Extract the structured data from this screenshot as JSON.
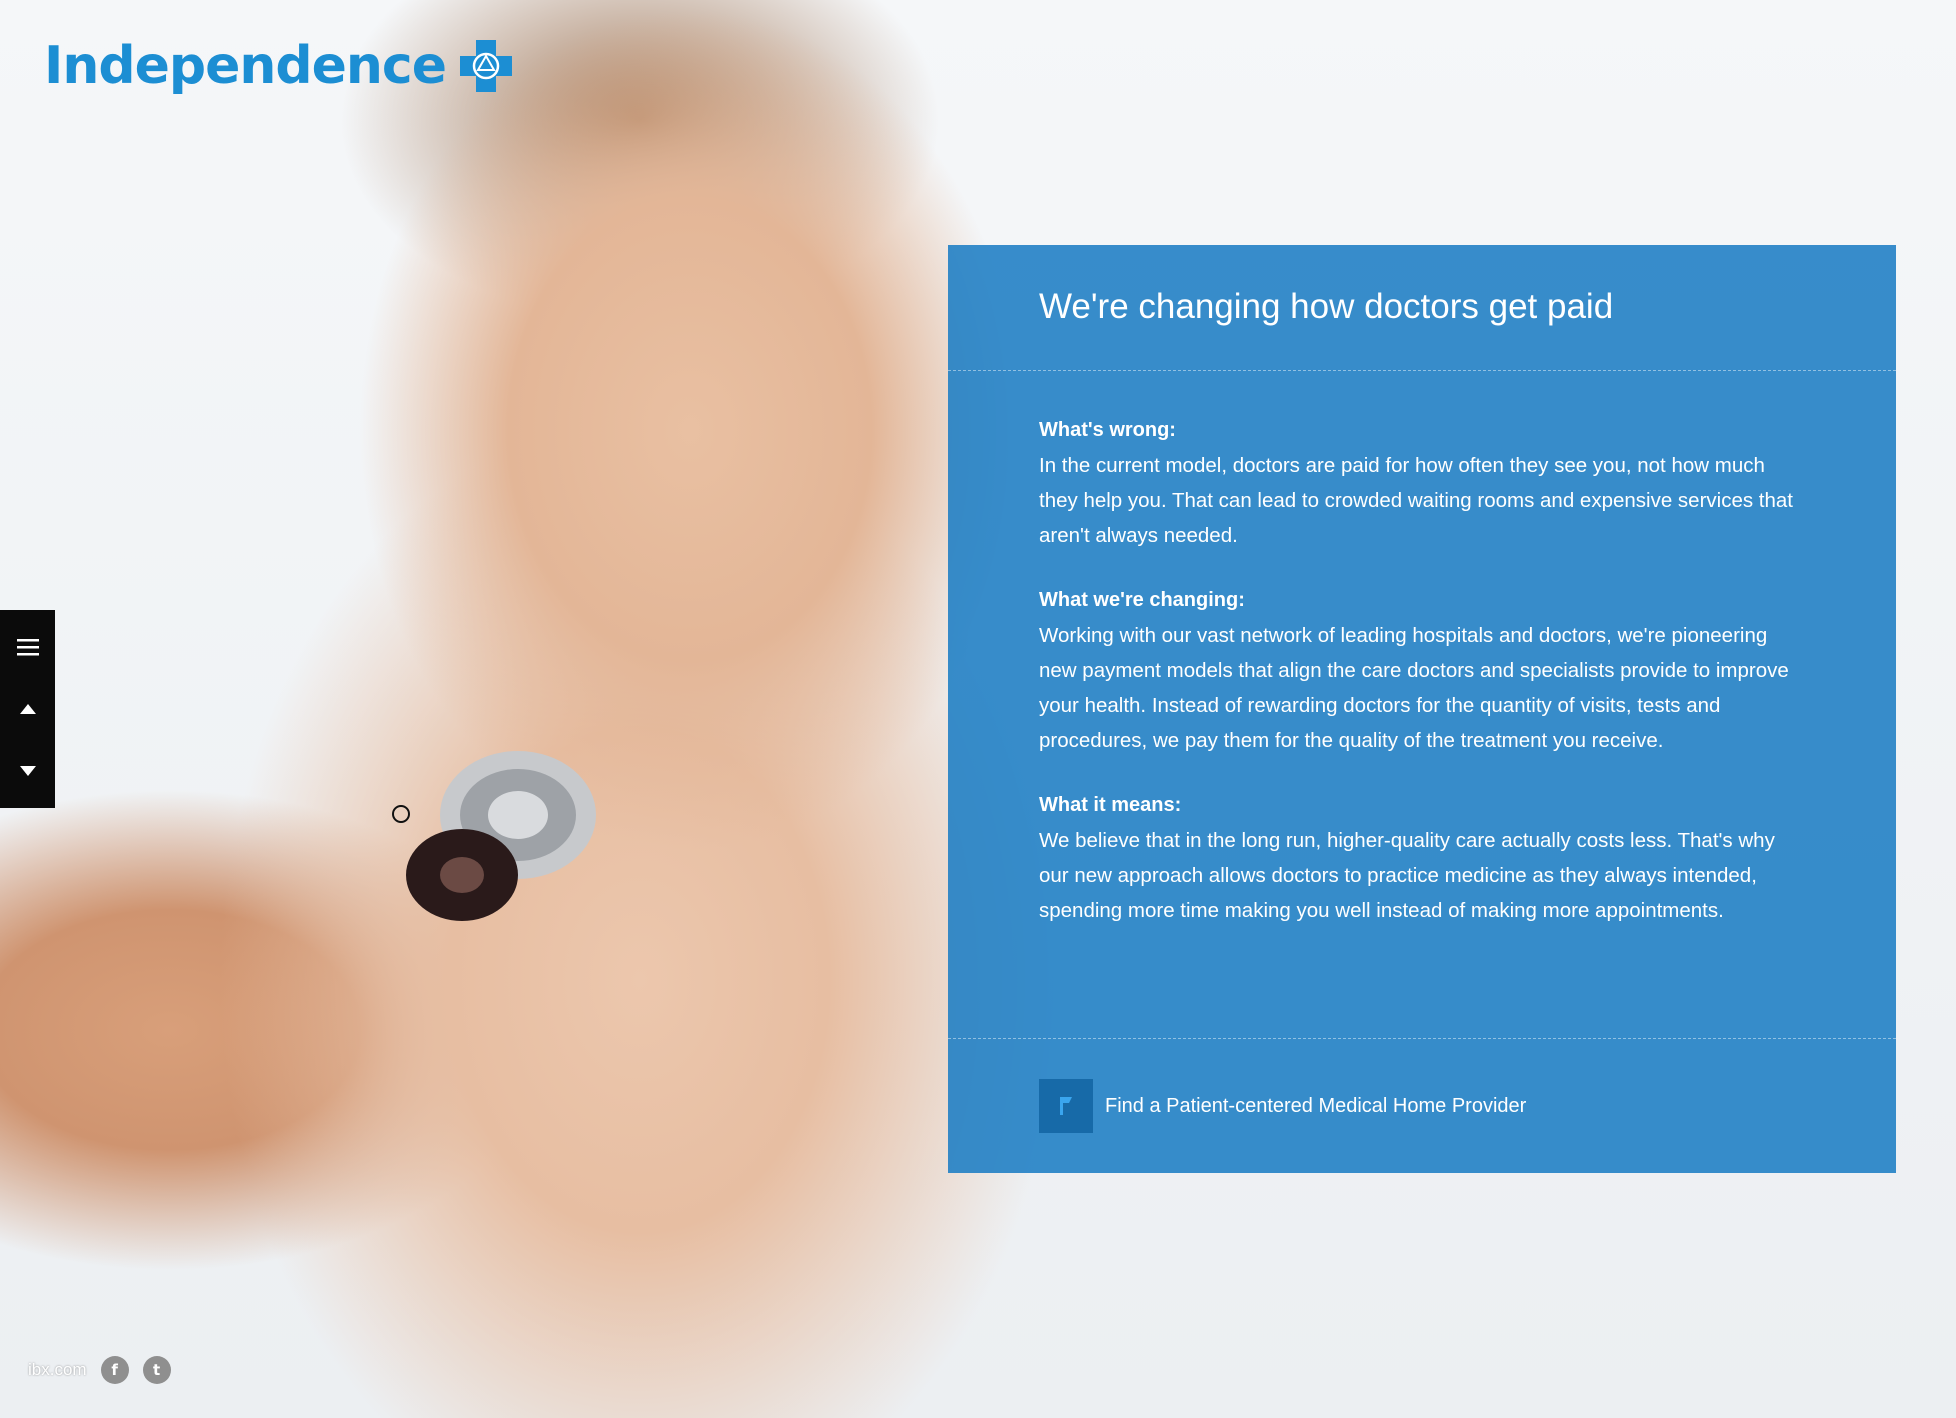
{
  "brand": {
    "name": "Independence",
    "color": "#1c8ed3"
  },
  "panel": {
    "title": "We're changing how doctors get paid",
    "sections": [
      {
        "heading": "What's wrong:",
        "text": "In the current model, doctors are paid for how often they see you, not how much they help you. That can lead to crowded waiting rooms and expensive services that aren't always needed."
      },
      {
        "heading": "What we're changing:",
        "text": "Working with our vast network of leading hospitals and doctors, we're pioneering new payment models that align the care doctors and specialists provide to improve your health. Instead of rewarding doctors for the quantity of visits, tests and procedures, we pay them for the quality of the treatment you receive."
      },
      {
        "heading": "What it means:",
        "text": "We believe that in the long run, higher-quality care actually costs less. That's why our new approach allows doctors to practice medicine as they always intended, spending more time making you well instead of making more appointments."
      }
    ],
    "cta": {
      "label": "Find a Patient-centered Medical Home Provider",
      "icon": "flag-icon"
    },
    "color": "#1c7dc4"
  },
  "side_nav": {
    "icons": [
      "menu-icon",
      "arrow-up-icon",
      "arrow-down-icon"
    ]
  },
  "footer": {
    "link": "ibx.com",
    "social": [
      "facebook-icon",
      "twitter-icon"
    ],
    "facebook_glyph": "f",
    "twitter_glyph": "t"
  }
}
